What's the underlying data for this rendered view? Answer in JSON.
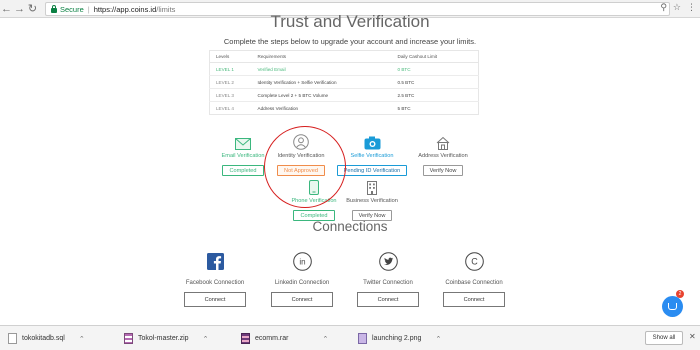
{
  "browser": {
    "secure_label": "Secure",
    "url_host": "https://app.coins.id",
    "url_path": "/limits"
  },
  "page": {
    "title": "Trust and Verification",
    "subtitle": "Complete the steps below to upgrade your account and increase your limits."
  },
  "limits_table": {
    "headers": [
      "Levels",
      "Requirements",
      "Daily Cashout Limit"
    ],
    "rows": [
      {
        "level": "LEVEL 1",
        "requirement": "Verified Email",
        "limit": "0 BTC"
      },
      {
        "level": "LEVEL 2",
        "requirement": "Identity Verification + Selfie Verification",
        "limit": "0.5 BTC"
      },
      {
        "level": "LEVEL 3",
        "requirement": "Complete Level 2 + 5 BTC Volume",
        "limit": "2.5 BTC"
      },
      {
        "level": "LEVEL 4",
        "requirement": "Address Verification",
        "limit": "5 BTC"
      }
    ]
  },
  "verifications": [
    {
      "label": "Email Verification",
      "button": "Completed",
      "icon": "mail-icon"
    },
    {
      "label": "Identity Verification",
      "button": "Not Approved",
      "icon": "user-icon"
    },
    {
      "label": "Selfie Verification",
      "button": "Pending ID Verification",
      "icon": "camera-icon"
    },
    {
      "label": "Address Verification",
      "button": "Verify Now",
      "icon": "home-icon"
    },
    {
      "label": "Phone Verification",
      "button": "Completed",
      "icon": "phone-icon"
    },
    {
      "label": "Business Verification",
      "button": "Verify Now",
      "icon": "building-icon"
    }
  ],
  "connections": {
    "title": "Connections",
    "items": [
      {
        "label": "Facebook Connection",
        "button": "Connect",
        "icon": "facebook-icon"
      },
      {
        "label": "Linkedin Connection",
        "button": "Connect",
        "icon": "linkedin-icon"
      },
      {
        "label": "Twitter Connection",
        "button": "Connect",
        "icon": "twitter-icon"
      },
      {
        "label": "Coinbase Connection",
        "button": "Connect",
        "icon": "coinbase-icon"
      }
    ]
  },
  "chat": {
    "badge": "2"
  },
  "downloads": {
    "items": [
      {
        "name": "tokokitadb.sql"
      },
      {
        "name": "Tokol-master.zip"
      },
      {
        "name": "ecomm.rar"
      },
      {
        "name": "launching 2.png"
      }
    ],
    "show_all": "Show all"
  },
  "colors": {
    "accent_green": "#3bb77e",
    "accent_blue": "#1a9bd7",
    "warning_orange": "#f08c4a",
    "annotation_red": "#d61f1f"
  }
}
